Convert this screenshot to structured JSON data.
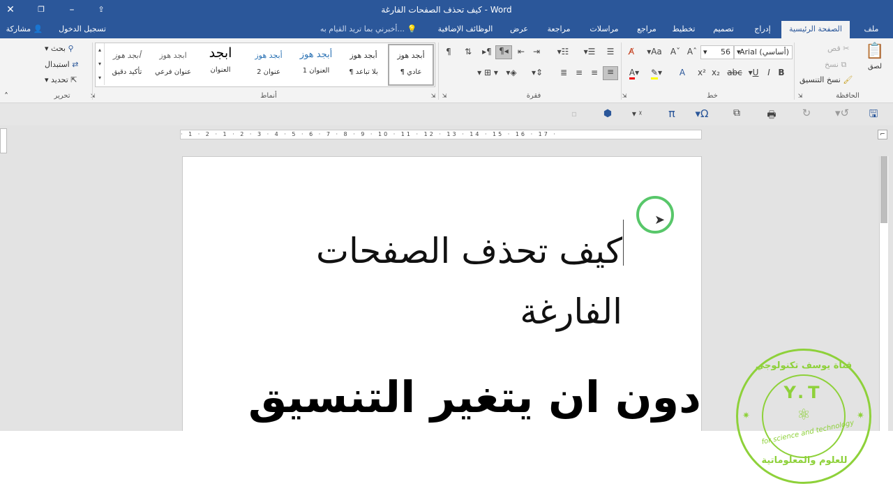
{
  "window": {
    "title": "كيف تحذف الصفحات الفارغة - Word"
  },
  "tabs": [
    {
      "label": "ملف"
    },
    {
      "label": "الصفحة الرئيسية",
      "active": true
    },
    {
      "label": "إدراج"
    },
    {
      "label": "تصميم"
    },
    {
      "label": "تخطيط"
    },
    {
      "label": "مراجع"
    },
    {
      "label": "مراسلات"
    },
    {
      "label": "مراجعة"
    },
    {
      "label": "عرض"
    },
    {
      "label": "الوظائف الإضافية"
    }
  ],
  "tell_me": "أخبرني بما تريد القيام به...",
  "account": {
    "sign_in": "تسجيل الدخول",
    "share": "مشاركة"
  },
  "clipboard": {
    "paste": "لصق",
    "cut": "قص",
    "copy": "نسخ",
    "format_painter": "نسخ التنسيق",
    "group_label": "الحافظة"
  },
  "font": {
    "name": "Arial (أساسي)",
    "size": "56",
    "group_label": "خط"
  },
  "paragraph": {
    "group_label": "فقرة"
  },
  "styles": {
    "group_label": "أنماط",
    "items": [
      {
        "preview": "أبجد هوز",
        "name": "¶ عادي"
      },
      {
        "preview": "أبجد هوز",
        "name": "¶ بلا تباعد"
      },
      {
        "preview": "أبجد هوز",
        "name": "العنوان 1"
      },
      {
        "preview": "أبجد هوز",
        "name": "عنوان 2"
      },
      {
        "preview": "ابجد",
        "name": "العنوان"
      },
      {
        "preview": "ابجد هوز",
        "name": "عنوان فرعي"
      },
      {
        "preview": "أبجد هوز",
        "name": "تأكيد دقيق"
      }
    ]
  },
  "editing": {
    "find": "بحث",
    "replace": "استبدال",
    "select": "تحديد",
    "group_label": "تحرير"
  },
  "ruler_text": "· 1 · 2 · 1 · 2 · 3 · 4 · 5 · 6 · 7 · 8 · 9 · 10 · 11 · 12 · 13 · 14 · 15 · 16 · 17 ·",
  "document": {
    "heading_line1": "كيف تحذف الصفحات",
    "heading_line2": "الفارغة"
  },
  "overlay": {
    "caption": "دون ان يتغير التنسيق",
    "logo_top": "قناة يوسف تكنولوجي",
    "logo_center": "Y.T",
    "logo_middle": "for science and technology",
    "logo_bottom": "للعلوم والمعلوماتية"
  },
  "colors": {
    "titlebar": "#2b579a",
    "ribbon": "#f3f3f3",
    "logo_green": "#8ed13a",
    "cursor_ring": "#58c76a"
  }
}
